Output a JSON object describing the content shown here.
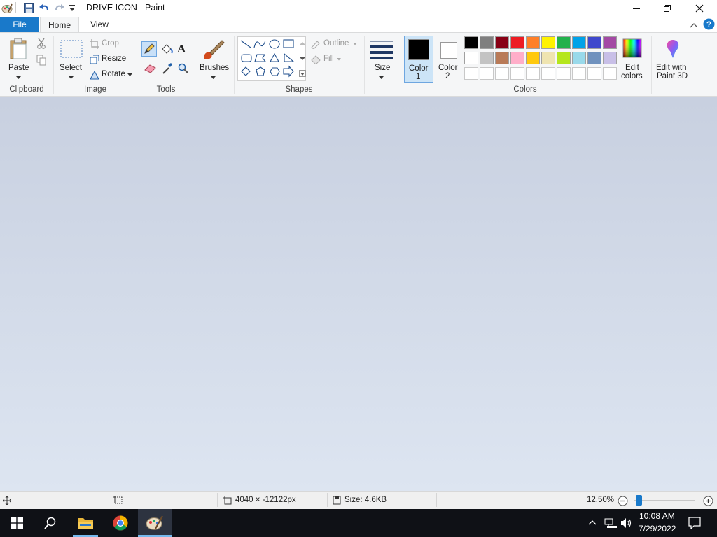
{
  "title": "DRIVE ICON - Paint",
  "tabs": {
    "file": "File",
    "home": "Home",
    "view": "View"
  },
  "clipboard": {
    "paste": "Paste",
    "group": "Clipboard"
  },
  "image": {
    "select": "Select",
    "crop": "Crop",
    "resize": "Resize",
    "rotate": "Rotate",
    "group": "Image"
  },
  "tools": {
    "group": "Tools"
  },
  "brushes": {
    "label": "Brushes"
  },
  "shapes": {
    "outline": "Outline",
    "fill": "Fill",
    "group": "Shapes"
  },
  "size": {
    "label": "Size"
  },
  "colors": {
    "color1_line1": "Color",
    "color1_line2": "1",
    "color2_line1": "Color",
    "color2_line2": "2",
    "edit_line1": "Edit",
    "edit_line2": "colors",
    "paint3d_line1": "Edit with",
    "paint3d_line2": "Paint 3D",
    "group": "Colors",
    "palette_row1": [
      "#000000",
      "#7f7f7f",
      "#880015",
      "#ed1c24",
      "#ff7f27",
      "#fff200",
      "#22b14c",
      "#00a2e8",
      "#3f48cc",
      "#a349a4"
    ],
    "palette_row2": [
      "#ffffff",
      "#c3c3c3",
      "#b97a57",
      "#ffaec9",
      "#ffc90e",
      "#efe4b0",
      "#b5e61d",
      "#99d9ea",
      "#7092be",
      "#c8bfe7"
    ]
  },
  "status": {
    "dimensions": "4040 × -12122px",
    "size": "Size: 4.6KB",
    "zoom": "12.50%"
  },
  "taskbar": {
    "time": "10:08 AM",
    "date": "7/29/2022"
  }
}
